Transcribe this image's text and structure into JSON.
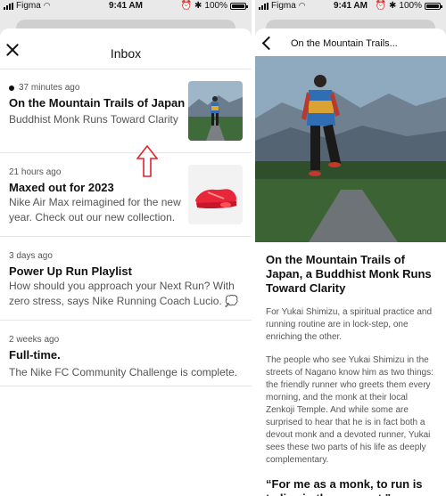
{
  "status_bar": {
    "carrier": "Figma",
    "time": "9:41 AM",
    "battery": "100%"
  },
  "inbox": {
    "title": "Inbox",
    "items": [
      {
        "timestamp": "37 minutes ago",
        "unread": true,
        "title": "On the Mountain Trails of Japan",
        "body": "Buddhist Monk Runs Toward Clarity",
        "thumbnail": "runner-mountain-photo"
      },
      {
        "timestamp": "21 hours ago",
        "unread": false,
        "title": "Maxed out for 2023",
        "body": "Nike Air Max reimagined for the new year. Check out our new collection.",
        "thumbnail": "red-sneaker-photo"
      },
      {
        "timestamp": "3 days ago",
        "unread": false,
        "title": "Power Up Run Playlist",
        "body": "How should you approach your Next Run? With zero stress, says Nike Running Coach Lucio. 💭"
      },
      {
        "timestamp": "2 weeks ago",
        "unread": false,
        "title": "Full-time.",
        "body": "The Nike FC Community Challenge is complete."
      }
    ]
  },
  "article": {
    "header_title": "On the Mountain Trails...",
    "headline": "On the Mountain Trails of Japan, a Buddhist Monk Runs Toward Clarity",
    "paragraphs": [
      "For Yukai Shimizu, a spiritual practice and running routine are in lock-step, one enriching the other.",
      "The people who see Yukai Shimizu in the streets of Nagano know him as two things: the friendly runner who greets them every morning, and the monk at their local Zenkoji Temple. And while some are surprised to hear that he is in fact both a devout monk and a devoted runner, Yukai sees these two parts of his life as deeply complementary."
    ],
    "quote": "“For me as a monk, to run is to live in the moment.”"
  },
  "colors": {
    "annotation_arrow": "#e0242c",
    "sneaker": "#e8263a"
  }
}
